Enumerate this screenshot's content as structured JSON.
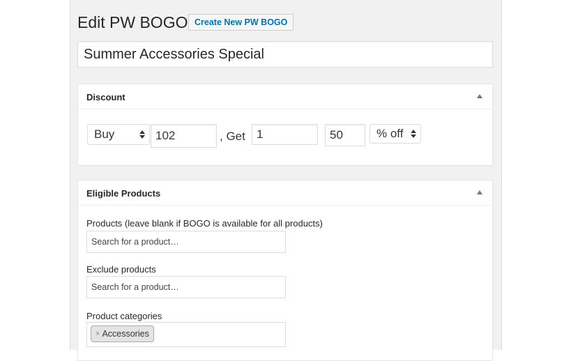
{
  "header": {
    "title": "Edit PW BOGO",
    "action_label": "Create New PW BOGO"
  },
  "post_title": {
    "value": "Summer Accessories Special"
  },
  "discount_box": {
    "title": "Discount",
    "type_select": "Buy",
    "buy_qty": "102",
    "get_text": ", Get",
    "get_qty": "1",
    "discount_value": "50",
    "discount_type_select": "% off"
  },
  "eligible_box": {
    "title": "Eligible Products",
    "products_label": "Products (leave blank if BOGO is available for all products)",
    "products_placeholder": "Search for a product…",
    "exclude_label": "Exclude products",
    "exclude_placeholder": "Search for a product…",
    "categories_label": "Product categories",
    "categories": [
      {
        "remove": "×",
        "label": "Accessories"
      }
    ]
  },
  "icons": {
    "collapse": "triangle-up-icon",
    "select": "select-arrows-icon"
  },
  "colors": {
    "link": "#0073aa",
    "background": "#f1f1f1"
  }
}
